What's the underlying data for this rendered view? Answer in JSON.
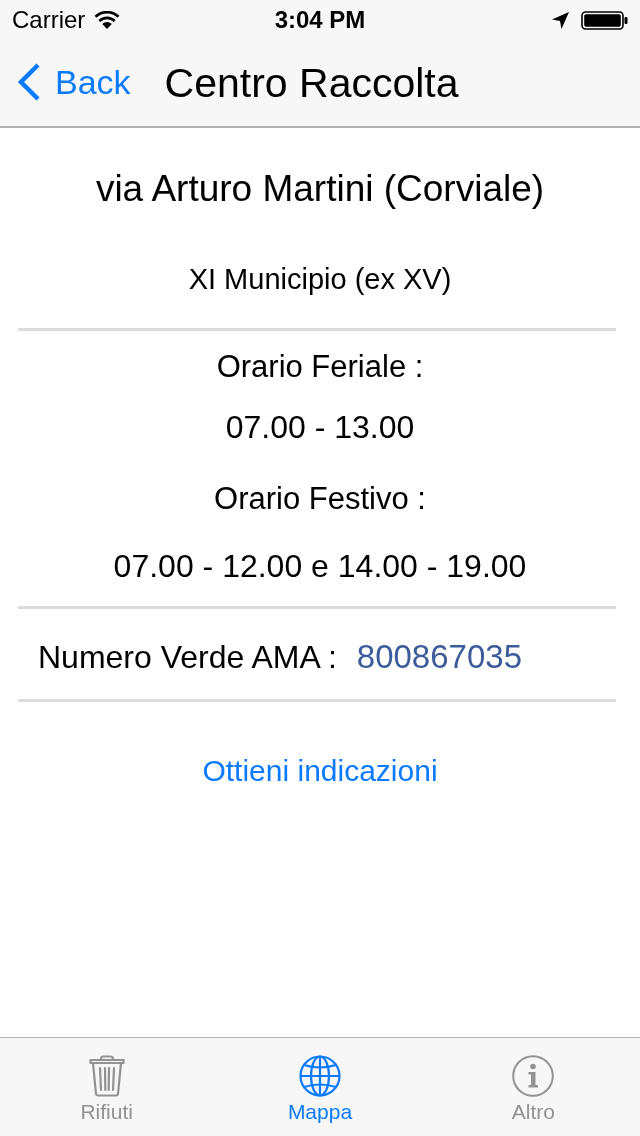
{
  "status_bar": {
    "carrier": "Carrier",
    "time": "3:04 PM"
  },
  "nav_bar": {
    "back": "Back",
    "title": "Centro Raccolta"
  },
  "location": {
    "name": "via Arturo Martini (Corviale)",
    "district": "XI Municipio (ex XV)"
  },
  "hours": [
    {
      "label": "Orario Feriale :",
      "times": "07.00 - 13.00"
    },
    {
      "label": "Orario Festivo :",
      "times": "07.00 - 12.00 e 14.00 - 19.00"
    }
  ],
  "contact": {
    "label": "Numero Verde AMA :",
    "phone": "800867035"
  },
  "directions_button": "Ottieni indicazioni",
  "tabs": [
    {
      "label": "Rifiuti",
      "selected": false
    },
    {
      "label": "Mappa",
      "selected": true
    },
    {
      "label": "Altro",
      "selected": false
    }
  ]
}
